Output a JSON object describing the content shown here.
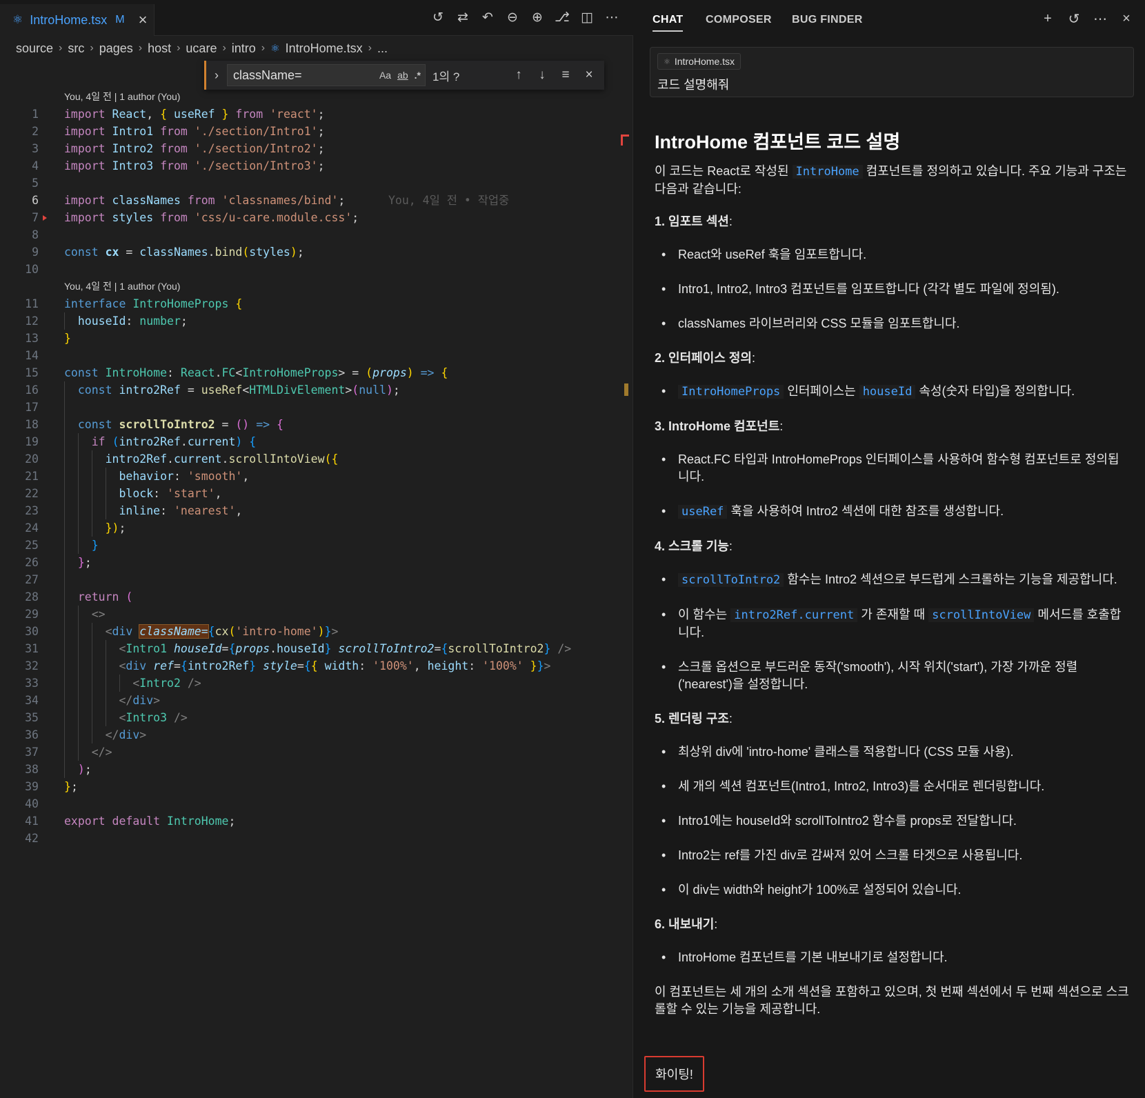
{
  "editor": {
    "tab": {
      "name": "IntroHome.tsx",
      "modified": "M"
    },
    "breadcrumb": [
      "source",
      "src",
      "pages",
      "host",
      "ucare",
      "intro",
      "IntroHome.tsx",
      "..."
    ],
    "find": {
      "query": "className=",
      "opt_case": "Aa",
      "opt_word": "ab",
      "opt_regex": ".*",
      "count": "1의 ?"
    },
    "blame_1": "You, 4일 전 | 1 author (You)",
    "blame_2": "You, 4일 전 | 1 author (You)",
    "inline_blame": "You, 4일 전 • 작업중",
    "line_numbers": [
      "1",
      "2",
      "3",
      "4",
      "5",
      "6",
      "7",
      "8",
      "9",
      "10",
      "11",
      "12",
      "13",
      "14",
      "15",
      "16",
      "17",
      "18",
      "19",
      "20",
      "21",
      "22",
      "23",
      "24",
      "25",
      "26",
      "27",
      "28",
      "29",
      "30",
      "31",
      "32",
      "33",
      "34",
      "35",
      "36",
      "37",
      "38",
      "39",
      "40",
      "41",
      "42"
    ]
  },
  "chat": {
    "tabs": [
      "CHAT",
      "COMPOSER",
      "BUG FINDER"
    ],
    "prompt": {
      "file_chip": "IntroHome.tsx",
      "text": "코드 설명해줘"
    },
    "answer": {
      "title": "IntroHome 컴포넌트 코드 설명",
      "intro_a": "이 코드는 React로 작성된",
      "intro_code": "IntroHome",
      "intro_b": "컴포넌트를 정의하고 있습니다. 주요 기능과 구조는 다음과 같습니다:",
      "s1_num": "1.",
      "s1_title": "임포트 섹션",
      "s1_colon": ":",
      "s1_items": [
        "React와 useRef 훅을 임포트합니다.",
        "Intro1, Intro2, Intro3 컴포넌트를 임포트합니다 (각각 별도 파일에 정의됨).",
        "classNames 라이브러리와 CSS 모듈을 임포트합니다."
      ],
      "s2_num": "2.",
      "s2_title": "인터페이스 정의",
      "s2_colon": ":",
      "s2_code1": "IntroHomeProps",
      "s2_text1": "인터페이스는",
      "s2_code2": "houseId",
      "s2_text2": "속성(숫자 타입)을 정의합니다.",
      "s3_num": "3.",
      "s3_title": "IntroHome 컴포넌트",
      "s3_colon": ":",
      "s3_item1": "React.FC 타입과 IntroHomeProps 인터페이스를 사용하여 함수형 컴포넌트로 정의됩니다.",
      "s3_code2": "useRef",
      "s3_text2": "훅을 사용하여 Intro2 섹션에 대한 참조를 생성합니다.",
      "s4_num": "4.",
      "s4_title": "스크롤 기능",
      "s4_colon": ":",
      "s4_code1": "scrollToIntro2",
      "s4_text1": "함수는 Intro2 섹션으로 부드럽게 스크롤하는 기능을 제공합니다.",
      "s4_text2a": "이 함수는",
      "s4_code2a": "intro2Ref.current",
      "s4_text2b": "가 존재할 때",
      "s4_code2b": "scrollIntoView",
      "s4_text2c": "메서드를 호출합니다.",
      "s4_item3": "스크롤 옵션으로 부드러운 동작('smooth'), 시작 위치('start'), 가장 가까운 정렬('nearest')을 설정합니다.",
      "s5_num": "5.",
      "s5_title": "렌더링 구조",
      "s5_colon": ":",
      "s5_items": [
        "최상위 div에 'intro-home' 클래스를 적용합니다 (CSS 모듈 사용).",
        "세 개의 섹션 컴포넌트(Intro1, Intro2, Intro3)를 순서대로 렌더링합니다.",
        "Intro1에는 houseId와 scrollToIntro2 함수를 props로 전달합니다.",
        "Intro2는 ref를 가진 div로 감싸져 있어 스크롤 타겟으로 사용됩니다.",
        "이 div는 width와 height가 100%로 설정되어 있습니다."
      ],
      "s6_num": "6.",
      "s6_title": "내보내기",
      "s6_colon": ":",
      "s6_items": [
        "IntroHome 컴포넌트를 기본 내보내기로 설정합니다."
      ],
      "summary": "이 컴포넌트는 세 개의 소개 섹션을 포함하고 있으며, 첫 번째 섹션에서 두 번째 섹션으로 스크롤할 수 있는 기능을 제공합니다.",
      "closing": "화이팅!"
    }
  },
  "colors": {
    "accent": "#4aa3ff",
    "highlight_border": "#d93b30",
    "find_border": "#d1812f"
  }
}
